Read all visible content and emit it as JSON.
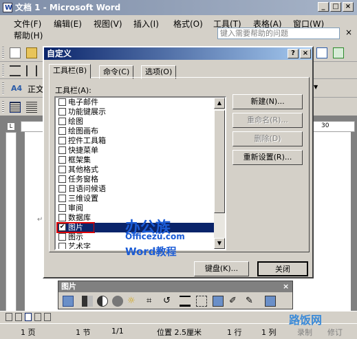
{
  "window": {
    "title": "文档 1 - Microsoft Word",
    "controls": {
      "minimize": "_",
      "maximize": "□",
      "close": "×"
    }
  },
  "menu": {
    "items": [
      "文件(F)",
      "编辑(E)",
      "视图(V)",
      "插入(I)",
      "格式(O)",
      "工具(T)",
      "表格(A)",
      "窗口(W)",
      "帮助(H)"
    ],
    "help_placeholder": "键入需要帮助的问题",
    "close_glyph": "×"
  },
  "format_toolbar": {
    "style_prefix": "A4",
    "style_label": "正文"
  },
  "ruler": {
    "right_value": "30"
  },
  "dialog": {
    "title": "自定义",
    "help_btn": "?",
    "close_btn": "×",
    "tabs": [
      "工具栏(B)",
      "命令(C)",
      "选项(O)"
    ],
    "list_label": "工具栏(A):",
    "toolbars": [
      {
        "label": "电子邮件",
        "checked": false
      },
      {
        "label": "功能键展示",
        "checked": false
      },
      {
        "label": "绘图",
        "checked": false
      },
      {
        "label": "绘图画布",
        "checked": false
      },
      {
        "label": "控件工具箱",
        "checked": false
      },
      {
        "label": "快捷菜单",
        "checked": false
      },
      {
        "label": "框架集",
        "checked": false
      },
      {
        "label": "其他格式",
        "checked": false
      },
      {
        "label": "任务窗格",
        "checked": false
      },
      {
        "label": "日语问候语",
        "checked": false
      },
      {
        "label": "三维设置",
        "checked": false
      },
      {
        "label": "审阅",
        "checked": false
      },
      {
        "label": "数据库",
        "checked": false
      },
      {
        "label": "图片",
        "checked": true,
        "selected": true
      },
      {
        "label": "图示",
        "checked": false
      },
      {
        "label": "艺术字",
        "checked": false
      }
    ],
    "buttons": {
      "new": "新建(N)...",
      "rename": "重命名(R)...",
      "delete": "删除(D)",
      "reset": "重新设置(R)...",
      "keyboard": "键盘(K)...",
      "close": "关闭"
    }
  },
  "picture_toolbar": {
    "title": "图片",
    "close": "×"
  },
  "statusbar": {
    "page": "1 页",
    "section": "1 节",
    "pages": "1/1",
    "position": "位置 2.5厘米",
    "line": "1 行",
    "col": "1 列",
    "rec": "录制",
    "mod": "修订"
  },
  "watermarks": {
    "brand1": "办公族",
    "brand1_url": "Officezu.com",
    "brand1_sub": "Word教程",
    "brand2": "路饭网"
  },
  "colors": {
    "title_active": "#0a246a",
    "title_inactive": "#7f8ea8",
    "selection": "#0a246a",
    "highlight_box": "#e00000",
    "watermark_blue": "#1a5bd6"
  }
}
